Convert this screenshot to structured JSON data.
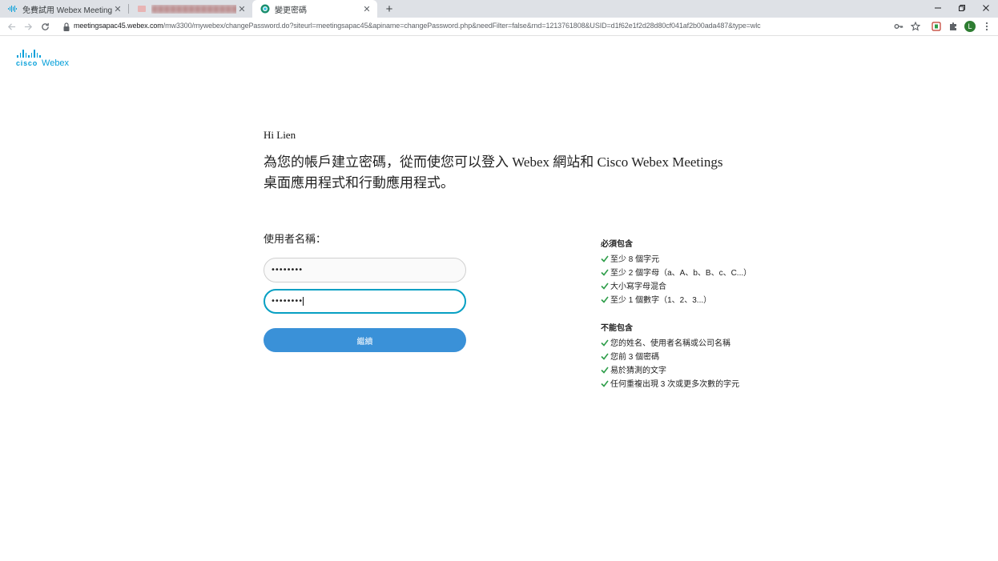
{
  "browser": {
    "tabs": [
      {
        "title": "免費試用 Webex Meetings | 一",
        "active": false
      },
      {
        "title": "",
        "active": false
      },
      {
        "title": "變更密碼",
        "active": true
      }
    ],
    "url_host": "meetingsapac45.webex.com",
    "url_path": "/mw3300/mywebex/changePassword.do?siteurl=meetingsapac45&apiname=changePassword.php&needFilter=false&rnd=1213761808&USID=d1f62e1f2d28d80cf041af2b00ada487&type=wlc",
    "profile_initial": "L"
  },
  "logo": {
    "cisco": "cisco",
    "webex": "Webex"
  },
  "page": {
    "greeting": "Hi Lien",
    "intro_line1": "為您的帳戶建立密碼，從而使您可以登入 Webex 網站和 Cisco Webex Meetings",
    "intro_line2": "桌面應用程式和行動應用程式。",
    "username_label": "使用者名稱：",
    "username_value": "",
    "password_value": "••••••••",
    "confirm_password_value": "••••••••",
    "continue_label": "繼續"
  },
  "rules": {
    "must_title": "必須包含",
    "must_items": [
      "至少 8 個字元",
      "至少 2 個字母（a、A、b、B、c、C...）",
      "大小寫字母混合",
      "至少 1 個數字（1、2、3...）"
    ],
    "not_title": "不能包含",
    "not_items": [
      "您的姓名、使用者名稱或公司名稱",
      "您前 3 個密碼",
      "易於猜測的文字",
      "任何重複出現 3 次或更多次數的字元"
    ]
  },
  "colors": {
    "accent": "#3a91d8",
    "check": "#2e9e4a",
    "focus": "#07a0c3",
    "cisco_blue": "#049fd9"
  }
}
